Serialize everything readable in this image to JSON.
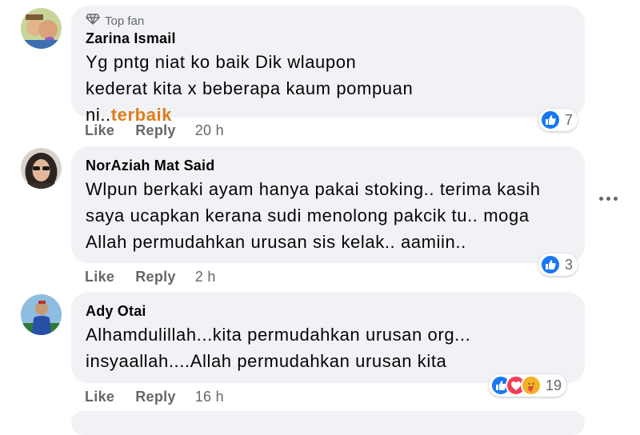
{
  "comments": [
    {
      "badge": "Top fan",
      "author": "Zarina Ismail",
      "text_plain": "Yg pntg niat ko baik Dik wlaupon kederat kita x beberapa kaum pompuan ni..",
      "text_highlight": "terbaik",
      "like": "Like",
      "reply": "Reply",
      "time": "20 h",
      "reaction_count": "7",
      "reaction_icons": [
        "like-icon"
      ]
    },
    {
      "author": "NorAziah Mat Said",
      "text_plain": "Wlpun berkaki ayam hanya pakai stoking.. terima kasih saya ucapkan kerana sudi menolong pakcik tu.. moga Allah permudahkan urusan sis kelak.. aamiin..",
      "like": "Like",
      "reply": "Reply",
      "time": "2 h",
      "reaction_count": "3",
      "reaction_icons": [
        "like-icon"
      ]
    },
    {
      "author": "Ady Otai",
      "text_plain": "Alhamdulillah...kita permudahkan urusan org... insyaallah....Allah permudahkan urusan kita",
      "like": "Like",
      "reply": "Reply",
      "time": "16 h",
      "reaction_count": "19",
      "reaction_icons": [
        "like-icon",
        "love-icon",
        "care-icon"
      ]
    }
  ],
  "colors": {
    "bubble": "#f0f2f5",
    "like": "#1877f2",
    "love": "#f33e58",
    "care": "#f7b125",
    "highlight": "#e07c1a",
    "meta": "#65676b"
  }
}
